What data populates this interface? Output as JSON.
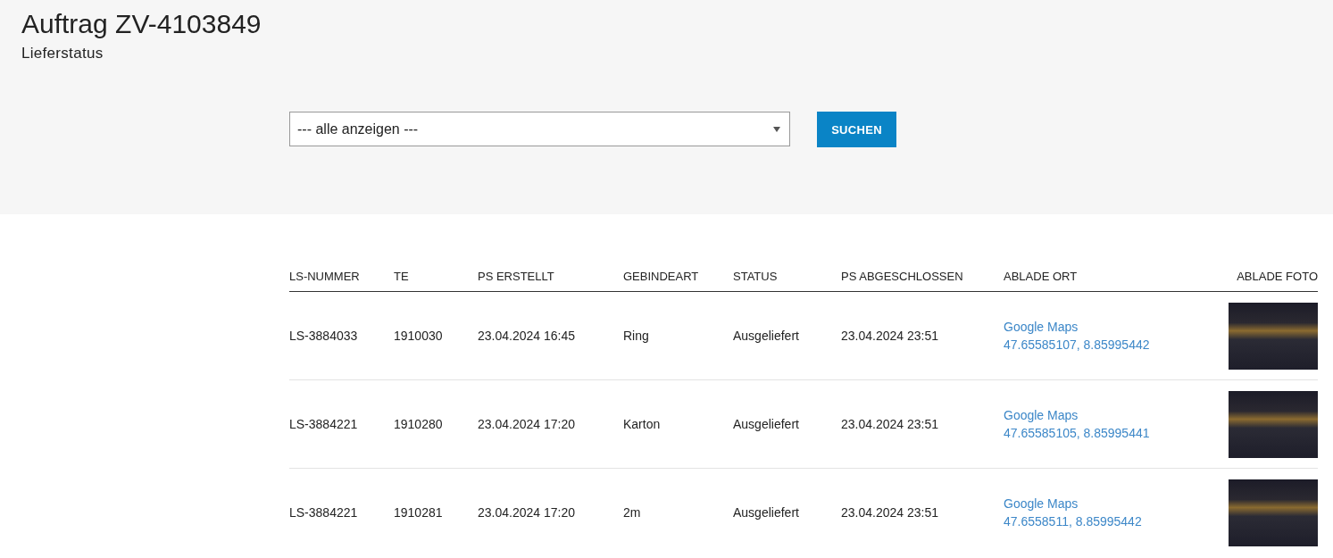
{
  "header": {
    "title": "Auftrag ZV-4103849",
    "subtitle": "Lieferstatus"
  },
  "filter": {
    "value": "--- alle anzeigen ---",
    "button": "SUCHEN"
  },
  "table": {
    "columns": [
      "LS-NUMMER",
      "TE",
      "PS ERSTELLT",
      "GEBINDEART",
      "STATUS",
      "PS ABGESCHLOSSEN",
      "ABLADE ORT",
      "ABLADE FOTO"
    ],
    "rows": [
      {
        "ls_nummer": "LS-3884033",
        "te": "1910030",
        "ps_erstellt": "23.04.2024 16:45",
        "gebindeart": "Ring",
        "status": "Ausgeliefert",
        "ps_abgeschlossen": "23.04.2024 23:51",
        "map_link": "Google Maps",
        "coordinates": "47.65585107, 8.85995442"
      },
      {
        "ls_nummer": "LS-3884221",
        "te": "1910280",
        "ps_erstellt": "23.04.2024 17:20",
        "gebindeart": "Karton",
        "status": "Ausgeliefert",
        "ps_abgeschlossen": "23.04.2024 23:51",
        "map_link": "Google Maps",
        "coordinates": "47.65585105, 8.85995441"
      },
      {
        "ls_nummer": "LS-3884221",
        "te": "1910281",
        "ps_erstellt": "23.04.2024 17:20",
        "gebindeart": "2m",
        "status": "Ausgeliefert",
        "ps_abgeschlossen": "23.04.2024 23:51",
        "map_link": "Google Maps",
        "coordinates": "47.6558511, 8.85995442"
      }
    ]
  }
}
